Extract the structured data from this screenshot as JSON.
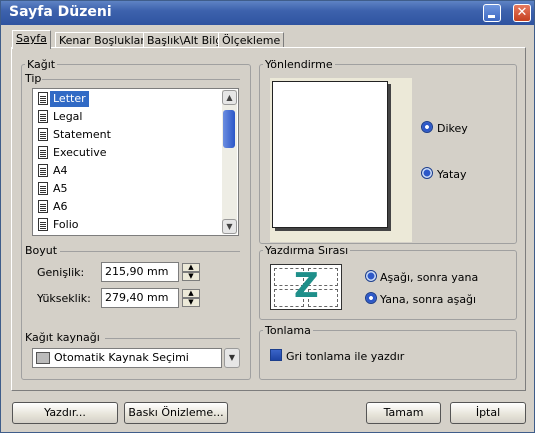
{
  "window": {
    "title": "Sayfa Düzeni",
    "close_glyph": "✕"
  },
  "tabs": [
    {
      "label": "Sayfa"
    },
    {
      "label": "Kenar Boşlukları"
    },
    {
      "label": "Başlık\\Alt Bilgi"
    },
    {
      "label": "Ölçekleme"
    }
  ],
  "paper": {
    "group_label": "Kağıt",
    "type_label": "Tip",
    "types": [
      "Letter",
      "Legal",
      "Statement",
      "Executive",
      "A4",
      "A5",
      "A6",
      "Folio"
    ],
    "selected_type": "Letter",
    "size_label": "Boyut",
    "width_label": "Genişlik:",
    "width_value": "215,90 mm",
    "height_label": "Yükseklik:",
    "height_value": "279,40 mm",
    "source_label": "Kağıt kaynağı",
    "source_value": "Otomatik Kaynak Seçimi"
  },
  "orientation": {
    "group_label": "Yönlendirme",
    "portrait_label": "Dikey",
    "landscape_label": "Yatay",
    "selected": "portrait"
  },
  "print_order": {
    "group_label": "Yazdırma Sırası",
    "down_then_over": "Aşağı, sonra yana",
    "over_then_down": "Yana, sonra aşağı",
    "selected": "over_then_down"
  },
  "toning": {
    "group_label": "Tonlama",
    "grayscale_label": "Gri tonlama ile yazdır",
    "grayscale_checked": true
  },
  "buttons": {
    "print": "Yazdır...",
    "preview": "Baskı Önizleme...",
    "ok": "Tamam",
    "cancel": "İptal"
  },
  "colors": {
    "accent": "#316ac5",
    "titlebar": "#3d62ad",
    "dialog_bg": "#d4d0c8"
  }
}
